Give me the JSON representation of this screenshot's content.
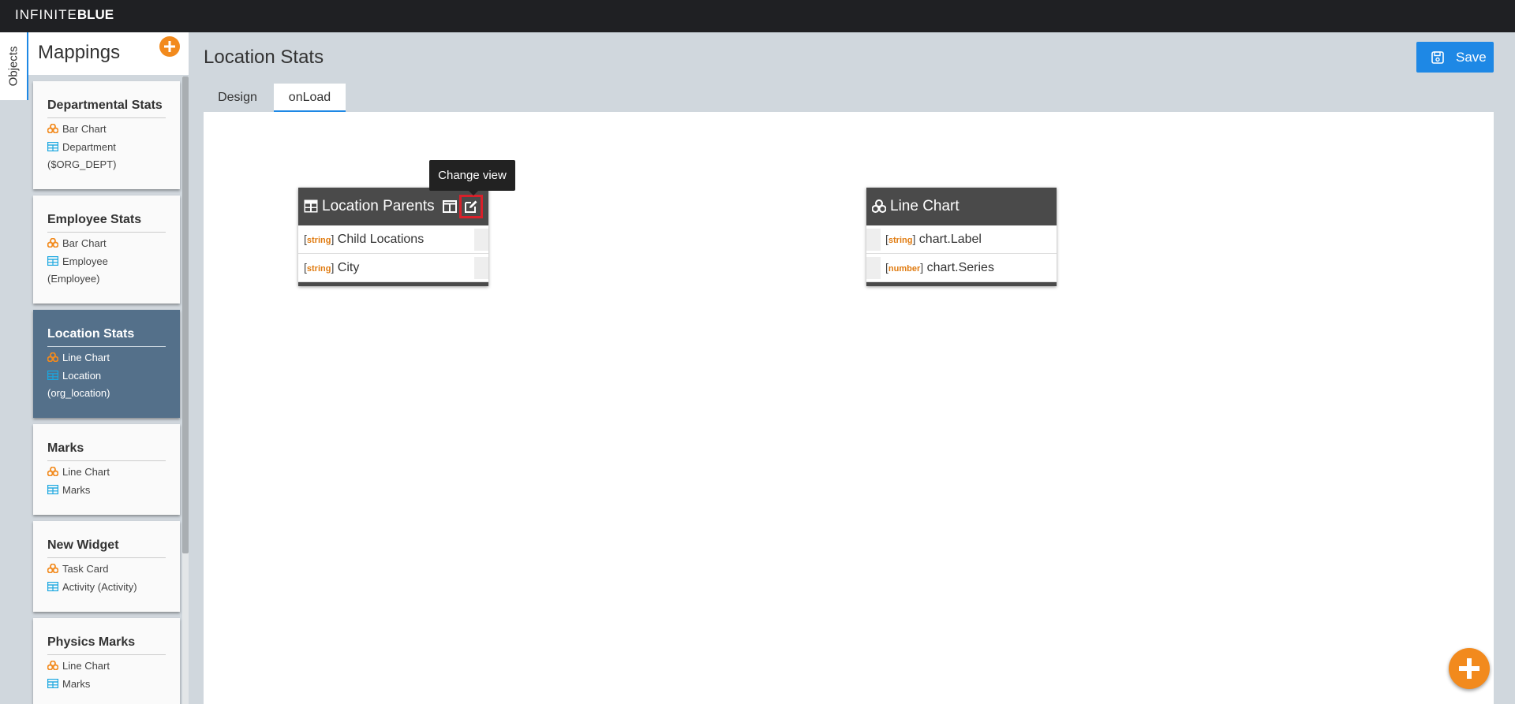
{
  "app": {
    "logo_thin": "INFINITE",
    "logo_bold": "BLUE"
  },
  "sidebar": {
    "objects_tab": "Objects",
    "title": "Mappings",
    "add_icon": "plus-circle-icon",
    "cards": [
      {
        "title": "Departmental Stats",
        "chart": "Bar Chart",
        "source": "Department",
        "source_detail": "($ORG_DEPT)",
        "active": false
      },
      {
        "title": "Employee Stats",
        "chart": "Bar Chart",
        "source": "Employee",
        "source_detail": "(Employee)",
        "active": false
      },
      {
        "title": "Location Stats",
        "chart": "Line Chart",
        "source": "Location",
        "source_detail": "(org_location)",
        "active": true
      },
      {
        "title": "Marks",
        "chart": "Line Chart",
        "source": "Marks",
        "source_detail": "",
        "active": false
      },
      {
        "title": "New Widget",
        "chart": "Task Card",
        "source": "Activity (Activity)",
        "source_detail": "",
        "active": false
      },
      {
        "title": "Physics Marks",
        "chart": "Line Chart",
        "source": "Marks",
        "source_detail": "",
        "active": false
      }
    ]
  },
  "main": {
    "title": "Location Stats",
    "save_label": "Save",
    "tabs": [
      {
        "label": "Design",
        "active": false
      },
      {
        "label": "onLoad",
        "active": true
      }
    ]
  },
  "canvas": {
    "tooltip": "Change view",
    "nodes": [
      {
        "title": "Location Parents",
        "icon": "table-icon",
        "fields": [
          {
            "type": "string",
            "name": "Child Locations"
          },
          {
            "type": "string",
            "name": "City"
          }
        ]
      },
      {
        "title": "Line Chart",
        "icon": "cubes-icon",
        "fields": [
          {
            "type": "string",
            "name": "chart.Label"
          },
          {
            "type": "number",
            "name": "chart.Series"
          }
        ]
      }
    ]
  },
  "colors": {
    "accent_blue": "#1e88e5",
    "accent_orange": "#f28a1d",
    "active_card": "#54708a",
    "node_header": "#4a4a4a",
    "topbar": "#1f2023"
  }
}
